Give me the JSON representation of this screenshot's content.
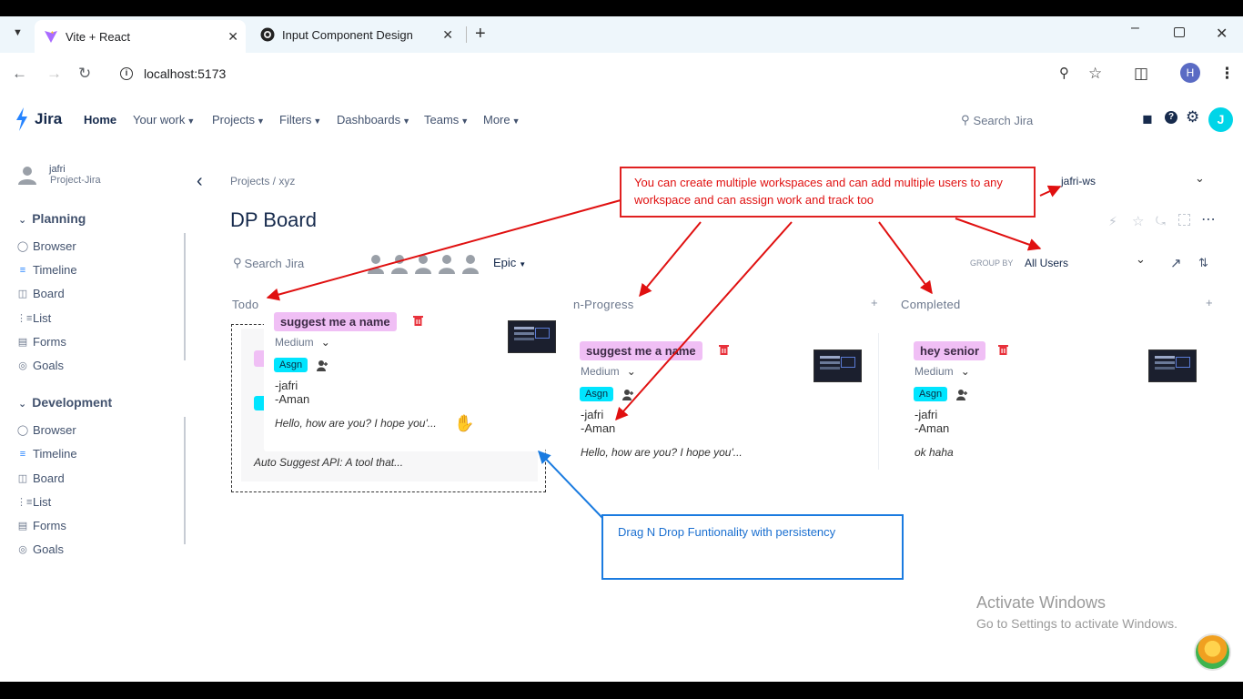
{
  "browser": {
    "tabs": [
      {
        "title": "Vite + React",
        "icon": "vite-icon"
      },
      {
        "title": "Input Component Design",
        "icon": "github-icon"
      }
    ],
    "new_tab": "+",
    "url": "localhost:5173",
    "profile_initial": "H"
  },
  "jira": {
    "logo": "Jira",
    "nav": [
      "Home",
      "Your work",
      "Projects",
      "Filters",
      "Dashboards",
      "Teams",
      "More"
    ],
    "search_placeholder": "Search Jira",
    "user_initial": "J"
  },
  "sidebar": {
    "user_name": "jafri",
    "project": "Project-Jira",
    "sections": [
      {
        "title": "Planning",
        "items": [
          "Browser",
          "Timeline",
          "Board",
          "List",
          "Forms",
          "Goals"
        ]
      },
      {
        "title": "Development",
        "items": [
          "Browser",
          "Timeline",
          "Board",
          "List",
          "Forms",
          "Goals"
        ]
      }
    ]
  },
  "board": {
    "breadcrumb": "Projects / xyz",
    "workspace": "jafri-ws",
    "title": "DP Board",
    "search_placeholder": "Search Jira",
    "epic_label": "Epic",
    "group_by_label": "GROUP BY",
    "group_by_value": "All Users",
    "columns": [
      {
        "title": "Todo"
      },
      {
        "title": "n-Progress"
      },
      {
        "title": "Completed"
      }
    ],
    "cards": [
      {
        "title": "suggest me a name",
        "priority": "Medium",
        "badge": "Asgn",
        "users": [
          "-jafri",
          "-Aman"
        ],
        "desc": "Hello, how are you? I hope you'..."
      },
      {
        "title": "suggest me a name",
        "priority": "Medium",
        "badge": "Asgn",
        "users": [
          "-jafri",
          "-Aman"
        ],
        "desc": "Hello, how are you? I hope you'..."
      },
      {
        "title": "hey senior",
        "priority": "Medium",
        "badge": "Asgn",
        "users": [
          "-jafri",
          "-Aman"
        ],
        "desc": "ok haha"
      }
    ],
    "todo_underlying_desc": "Auto Suggest API: A tool that..."
  },
  "annotations": {
    "red": "You can create multiple workspaces and can add  multiple users to any workspace and can assign work and track too",
    "blue": "Drag N Drop Funtionality with persistency"
  },
  "watermark": {
    "title": "Activate Windows",
    "subtitle": "Go to Settings to activate Windows."
  }
}
